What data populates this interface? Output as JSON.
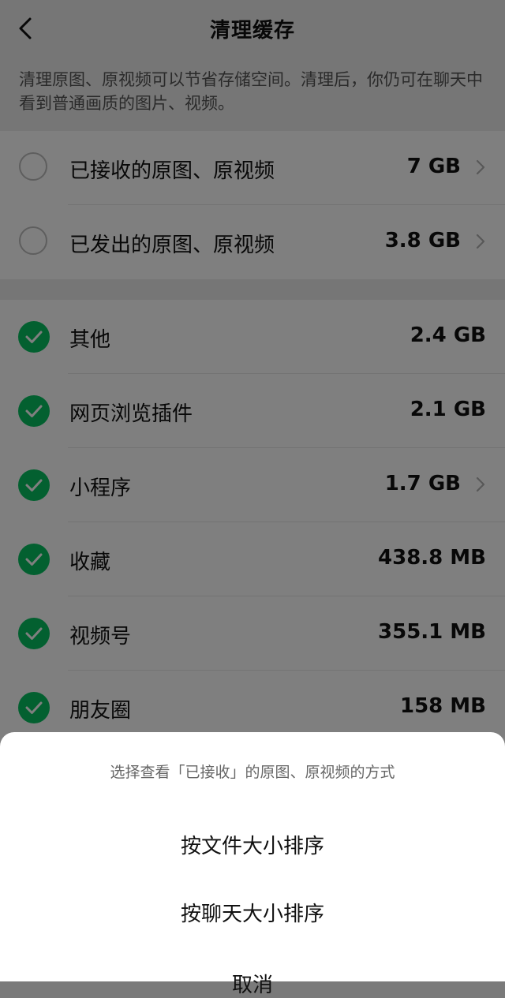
{
  "header": {
    "title": "清理缓存"
  },
  "description": "清理原图、原视频可以节省存储空间。清理后，你仍可在聊天中看到普通画质的图片、视频。",
  "originals": [
    {
      "label": "已接收的原图、原视频",
      "size": "7 GB",
      "checked": false,
      "chevron": true
    },
    {
      "label": "已发出的原图、原视频",
      "size": "3.8 GB",
      "checked": false,
      "chevron": true
    }
  ],
  "cache_items": [
    {
      "label": "其他",
      "size": "2.4 GB",
      "checked": true,
      "chevron": false
    },
    {
      "label": "网页浏览插件",
      "size": "2.1 GB",
      "checked": true,
      "chevron": false
    },
    {
      "label": "小程序",
      "size": "1.7 GB",
      "checked": true,
      "chevron": true
    },
    {
      "label": "收藏",
      "size": "438.8 MB",
      "checked": true,
      "chevron": false
    },
    {
      "label": "视频号",
      "size": "355.1 MB",
      "checked": true,
      "chevron": false
    },
    {
      "label": "朋友圈",
      "size": "158 MB",
      "checked": true,
      "chevron": false
    }
  ],
  "sheet": {
    "title": "选择查看「已接收」的原图、原视频的方式",
    "option_by_file": "按文件大小排序",
    "option_by_chat": "按聊天大小排序",
    "cancel": "取消"
  },
  "colors": {
    "accent_green": "#07c160",
    "background": "#ededed"
  }
}
